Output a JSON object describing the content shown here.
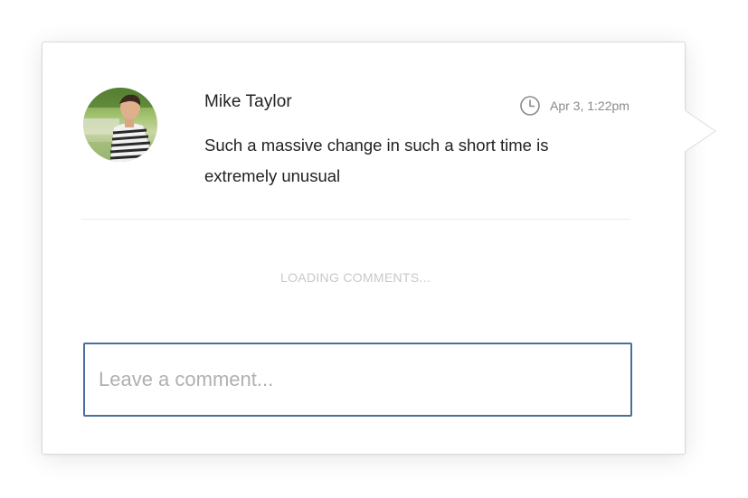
{
  "comment": {
    "author": "Mike Taylor",
    "timestamp": "Apr 3, 1:22pm",
    "body": "Such a massive change in such a short time is extremely unusual",
    "avatar_icon": "user-photo"
  },
  "comments_status": "LOADING COMMENTS...",
  "reply": {
    "placeholder": "Leave a comment...",
    "value": ""
  },
  "colors": {
    "input_border": "#4a6f9b",
    "muted_text": "#8a8a8a",
    "loading_text": "#c8c8c8",
    "body_text": "#222222"
  }
}
